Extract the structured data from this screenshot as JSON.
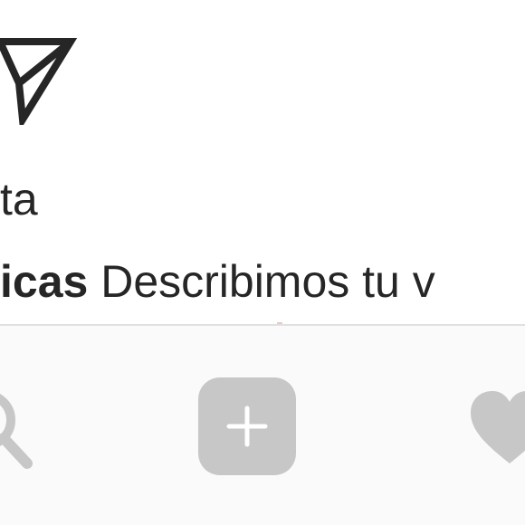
{
  "post": {
    "likes_text": "ta",
    "caption": {
      "username": "icas",
      "text": " Describimos tu v"
    },
    "share_icon": "paper-plane-icon"
  },
  "bottom_nav": {
    "items": [
      {
        "icon": "search-icon"
      },
      {
        "icon": "plus-icon"
      },
      {
        "icon": "heart-icon"
      }
    ]
  },
  "colors": {
    "text": "#262626",
    "nav_background": "#fafafa",
    "nav_icon": "#c7c7c7",
    "divider": "#e0e0e0"
  }
}
